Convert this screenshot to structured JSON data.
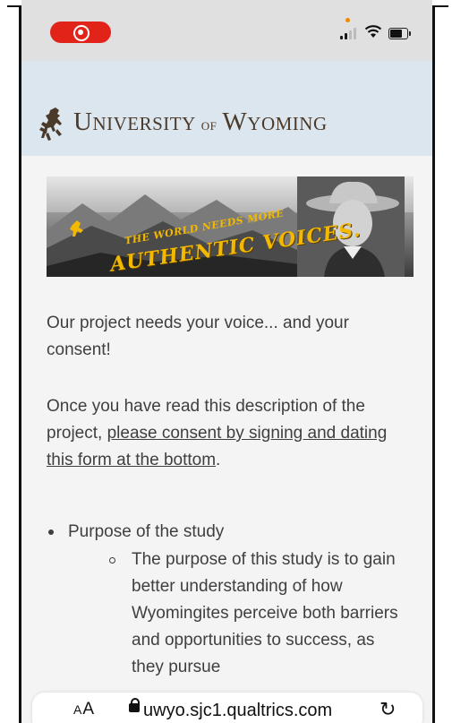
{
  "status_bar": {
    "recording_indicator": "screen-recording-icon",
    "icons": [
      "signal-icon",
      "wifi-icon",
      "battery-icon"
    ]
  },
  "header": {
    "logo_icon": "bronco-rider-icon",
    "wordmark": {
      "u": "U",
      "niversity": "NIVERSITY",
      "of": "OF",
      "w": "W",
      "yoming": "YOMING"
    }
  },
  "banner": {
    "tagline_top": "THE WORLD NEEDS MORE",
    "tagline_bottom": "AUTHENTIC VOICES."
  },
  "content": {
    "intro": "Our project needs your voice... and your consent!",
    "instruction_prefix": "Once you have read this description of the project, ",
    "instruction_link": "please consent by signing and dating this form at the bottom",
    "instruction_suffix": ".",
    "bullets": [
      {
        "label": "Purpose of the study",
        "sub": "The purpose of this study is to gain better understanding of how Wyomingites perceive both barriers and opportunities to success, as they pursue"
      }
    ]
  },
  "browser": {
    "text_size_label_small": "A",
    "text_size_label_big": "A",
    "url": "uwyo.sjc1.qualtrics.com",
    "reload_icon": "reload-icon"
  },
  "colors": {
    "header_bg": "#dbe6ef",
    "wordmark": "#4b3a2a",
    "banner_gold": "#f3b900",
    "record_red": "#e2231a"
  }
}
